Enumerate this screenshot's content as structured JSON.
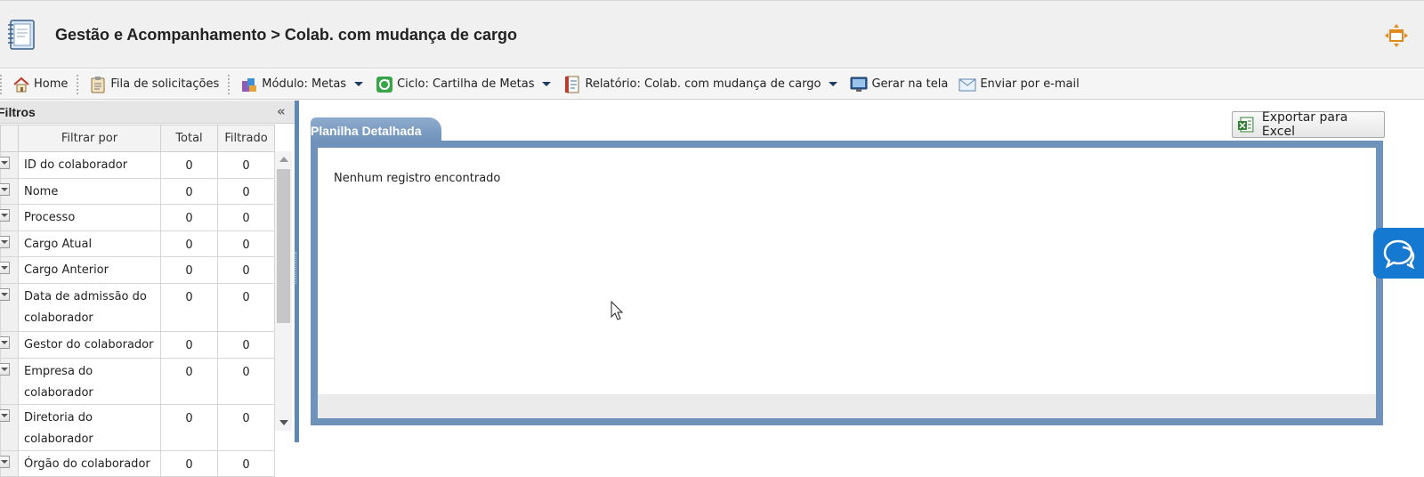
{
  "header": {
    "title": "Gestão e Acompanhamento > Colab. com mudança de cargo"
  },
  "toolbar": {
    "home": "Home",
    "queue": "Fila de solicitações",
    "module": "Módulo: Metas",
    "cycle": "Ciclo: Cartilha de Metas",
    "report": "Relatório: Colab. com mudança de cargo",
    "generate": "Gerar na tela",
    "email": "Enviar por e-mail"
  },
  "filters": {
    "title": "Filtros",
    "collapse": "«",
    "columns": [
      "Filtrar por",
      "Total",
      "Filtrado"
    ],
    "rows": [
      {
        "label": "ID do colaborador",
        "total": "0",
        "filtered": "0"
      },
      {
        "label": "Nome",
        "total": "0",
        "filtered": "0"
      },
      {
        "label": "Processo",
        "total": "0",
        "filtered": "0"
      },
      {
        "label": "Cargo Atual",
        "total": "0",
        "filtered": "0"
      },
      {
        "label": "Cargo Anterior",
        "total": "0",
        "filtered": "0"
      },
      {
        "label": "Data de admissão do colaborador",
        "total": "0",
        "filtered": "0"
      },
      {
        "label": "Gestor do colaborador",
        "total": "0",
        "filtered": "0"
      },
      {
        "label": "Empresa do colaborador",
        "total": "0",
        "filtered": "0"
      },
      {
        "label": "Diretoria do colaborador",
        "total": "0",
        "filtered": "0"
      },
      {
        "label": "Órgão do colaborador",
        "total": "0",
        "filtered": "0"
      }
    ]
  },
  "main": {
    "tab": "Planilha Detalhada",
    "export_button": "Exportar para Excel",
    "empty_message": "Nenhum registro encontrado"
  },
  "colors": {
    "accent": "#6f92ba",
    "chat": "#1679d1"
  }
}
